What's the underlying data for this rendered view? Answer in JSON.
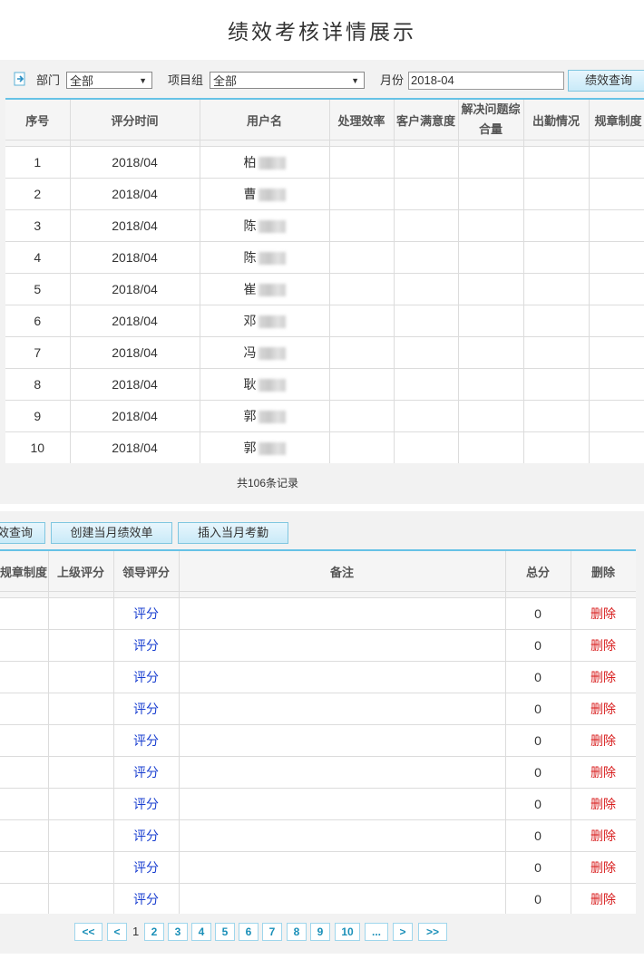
{
  "page_title": "绩效考核详情展示",
  "filters": {
    "dept_label": "部门",
    "dept_value": "全部",
    "group_label": "项目组",
    "group_value": "全部",
    "month_label": "月份",
    "month_value": "2018-04",
    "query_button": "绩效查询"
  },
  "actions": {
    "query_partial": "效查询",
    "create_button": "创建当月绩效单",
    "insert_button": "插入当月考勤"
  },
  "table1": {
    "headers": [
      "序号",
      "评分时间",
      "用户名",
      "处理效率",
      "客户满意度",
      "解决问题综合量",
      "出勤情况",
      "规章制度"
    ],
    "rows": [
      {
        "no": "1",
        "time": "2018/04",
        "user": "柏"
      },
      {
        "no": "2",
        "time": "2018/04",
        "user": "曹"
      },
      {
        "no": "3",
        "time": "2018/04",
        "user": "陈"
      },
      {
        "no": "4",
        "time": "2018/04",
        "user": "陈"
      },
      {
        "no": "5",
        "time": "2018/04",
        "user": "崔"
      },
      {
        "no": "6",
        "time": "2018/04",
        "user": "邓"
      },
      {
        "no": "7",
        "time": "2018/04",
        "user": "冯"
      },
      {
        "no": "8",
        "time": "2018/04",
        "user": "耿"
      },
      {
        "no": "9",
        "time": "2018/04",
        "user": "郭"
      },
      {
        "no": "10",
        "time": "2018/04",
        "user": "郭"
      }
    ]
  },
  "total_records": "共106条记录",
  "table2": {
    "headers": [
      "规章制度",
      "上级评分",
      "领导评分",
      "备注",
      "总分",
      "删除"
    ],
    "rows": [
      {
        "score_link": "评分",
        "total": "0",
        "delete": "删除"
      },
      {
        "score_link": "评分",
        "total": "0",
        "delete": "删除"
      },
      {
        "score_link": "评分",
        "total": "0",
        "delete": "删除"
      },
      {
        "score_link": "评分",
        "total": "0",
        "delete": "删除"
      },
      {
        "score_link": "评分",
        "total": "0",
        "delete": "删除"
      },
      {
        "score_link": "评分",
        "total": "0",
        "delete": "删除"
      },
      {
        "score_link": "评分",
        "total": "0",
        "delete": "删除"
      },
      {
        "score_link": "评分",
        "total": "0",
        "delete": "删除"
      },
      {
        "score_link": "评分",
        "total": "0",
        "delete": "删除"
      },
      {
        "score_link": "评分",
        "total": "0",
        "delete": "删除"
      }
    ]
  },
  "pager": {
    "first": "<<",
    "prev": "<",
    "current": "1",
    "pages": [
      "2",
      "3",
      "4",
      "5",
      "6",
      "7",
      "8",
      "9",
      "10"
    ],
    "ellipsis": "...",
    "next": ">",
    "last": ">>"
  },
  "colors": {
    "accent": "#66c2e6",
    "link": "#1a3fd0",
    "delete": "#d81e1e",
    "button_bg": "#c9eaf8"
  }
}
